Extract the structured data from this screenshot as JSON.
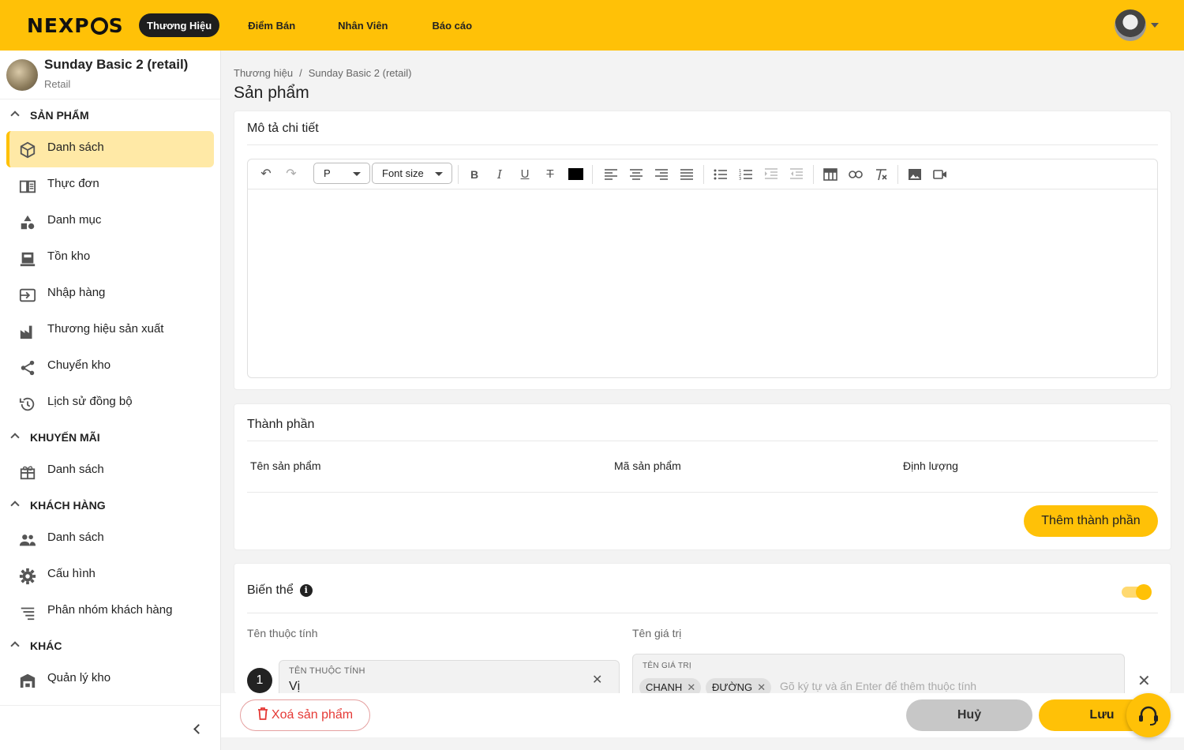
{
  "brand": {
    "logo": "NEXPOS",
    "accent": "#ffc107"
  },
  "topnav": {
    "items": [
      "Thương Hiệu",
      "Điểm Bán",
      "Nhân Viên",
      "Báo cáo"
    ]
  },
  "store": {
    "name": "Sunday Basic 2 (retail)",
    "type": "Retail"
  },
  "sidebar": {
    "sections": [
      {
        "title": "SẢN PHẨM",
        "items": [
          {
            "label": "Danh sách",
            "icon": "box-icon",
            "active": true
          },
          {
            "label": "Thực đơn",
            "icon": "menu-book-icon"
          },
          {
            "label": "Danh mục",
            "icon": "category-icon"
          },
          {
            "label": "Tồn kho",
            "icon": "inventory-icon"
          },
          {
            "label": "Nhập hàng",
            "icon": "import-icon"
          },
          {
            "label": "Thương hiệu sản xuất",
            "icon": "factory-icon"
          },
          {
            "label": "Chuyển kho",
            "icon": "share-icon"
          },
          {
            "label": "Lịch sử đồng bộ",
            "icon": "history-icon"
          }
        ]
      },
      {
        "title": "KHUYẾN MÃI",
        "items": [
          {
            "label": "Danh sách",
            "icon": "gift-icon"
          }
        ]
      },
      {
        "title": "KHÁCH HÀNG",
        "items": [
          {
            "label": "Danh sách",
            "icon": "people-icon"
          },
          {
            "label": "Cấu hình",
            "icon": "gear-icon"
          },
          {
            "label": "Phân nhóm khách hàng",
            "icon": "sort-icon"
          }
        ]
      },
      {
        "title": "KHÁC",
        "items": [
          {
            "label": "Quản lý kho",
            "icon": "warehouse-icon"
          }
        ]
      }
    ]
  },
  "breadcrumb": [
    "Thương hiệu",
    "Sunday Basic 2 (retail)"
  ],
  "page_title": "Sản phẩm",
  "description": {
    "title": "Mô tả chi tiết",
    "paragraph_select": "P",
    "font_size_select": "Font size"
  },
  "ingredients": {
    "title": "Thành phần",
    "columns": [
      "Tên sản phẩm",
      "Mã sản phẩm",
      "Định lượng"
    ],
    "add_label": "Thêm thành phần"
  },
  "variants": {
    "title": "Biến thể",
    "enabled": true,
    "attr_col": "Tên thuộc tính",
    "value_col": "Tên giá trị",
    "rows": [
      {
        "index": "1",
        "attr_caption": "Tên thuộc tính",
        "attr_value": "Vị",
        "value_caption": "Tên giá trị",
        "chips": [
          "CHANH",
          "ĐƯỜNG"
        ],
        "placeholder": "Gõ ký tự và ấn Enter để thêm thuộc tính"
      }
    ]
  },
  "actions": {
    "delete": "Xoá sản phẩm",
    "cancel": "Huỷ",
    "save": "Lưu"
  }
}
